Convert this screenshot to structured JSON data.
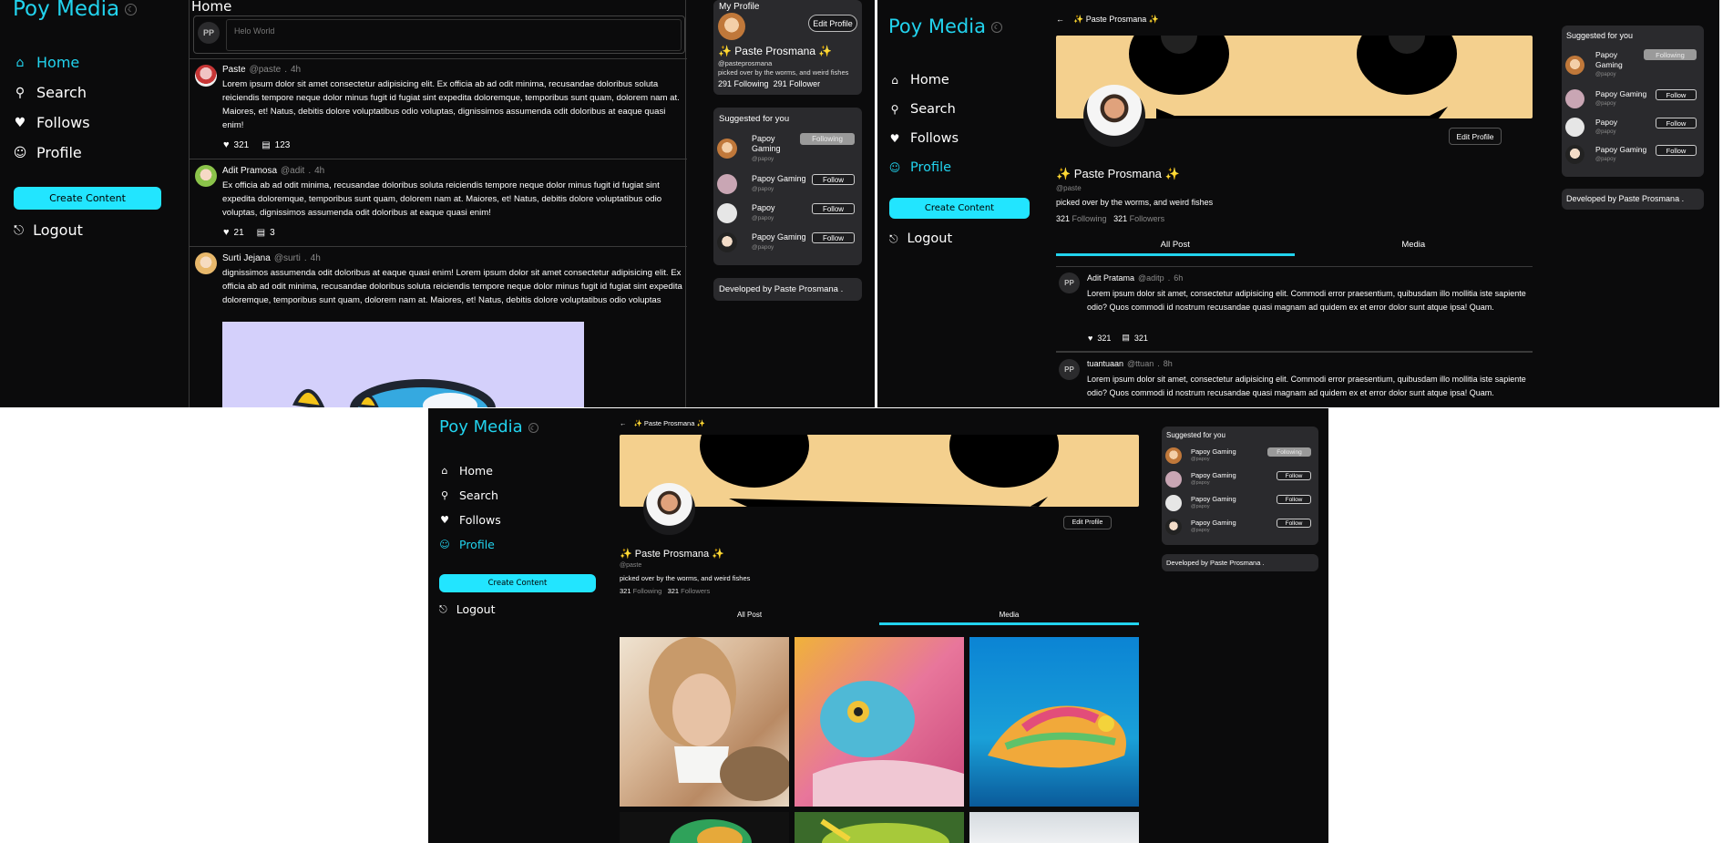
{
  "brand": "Poy Media",
  "theme_toggle_icon": "moon-icon",
  "nav": {
    "home": "Home",
    "search": "Search",
    "follows": "Follows",
    "profile": "Profile"
  },
  "create_label": "Create Content",
  "logout_label": "Logout",
  "home": {
    "title": "Home",
    "composer_avatar": "PP",
    "composer_placeholder": "Helo World",
    "posts": [
      {
        "name": "Paste",
        "handle": "@paste",
        "sep": ".",
        "time": "4h",
        "body": "Lorem ipsum dolor sit amet consectetur adipisicing elit. Ex officia ab ad odit minima, recusandae doloribus soluta reiciendis tempore neque dolor minus fugit id fugiat sint expedita doloremque, temporibus sunt quam, dolorem nam at. Maiores, et! Natus, debitis dolore voluptatibus odio voluptas, dignissimos assumenda odit doloribus at eaque quasi enim!",
        "likes": "321",
        "comments": "123"
      },
      {
        "name": "Adit Pramosa",
        "handle": "@adit",
        "sep": ".",
        "time": "4h",
        "body": "Ex officia ab ad odit minima, recusandae doloribus soluta reiciendis tempore neque dolor minus fugit id fugiat sint expedita doloremque, temporibus sunt quam, dolorem nam at. Maiores, et! Natus, debitis dolore voluptatibus odio voluptas, dignissimos assumenda odit doloribus at eaque quasi enim!",
        "likes": "21",
        "comments": "3"
      },
      {
        "name": "Surti Jejana",
        "handle": "@surti",
        "sep": ".",
        "time": "4h",
        "body": "dignissimos assumenda odit doloribus at eaque quasi enim! Lorem ipsum dolor sit amet consectetur adipisicing elit. Ex officia ab ad odit minima, recusandae doloribus soluta reiciendis tempore neque dolor minus fugit id fugiat sint expedita doloremque, temporibus sunt quam, dolorem nam at. Maiores, et! Natus, debitis dolore voluptatibus odio voluptas"
      }
    ],
    "my_profile": {
      "title": "My Profile",
      "edit": "Edit Profile",
      "name": "✨ Paste Prosmana ✨",
      "handle": "@pasteprosmana",
      "bio": "picked over by the worms, and weird fishes",
      "following_count": "291",
      "following_label": "Following",
      "follower_count": "291",
      "follower_label": "Follower"
    },
    "suggested": {
      "title": "Suggested for you",
      "items": [
        {
          "name": "Papoy Gaming",
          "handle": "@papoy",
          "btn": "Following"
        },
        {
          "name": "Papoy Gaming",
          "handle": "@papoy",
          "btn": "Follow"
        },
        {
          "name": "Papoy",
          "handle": "@papoy",
          "btn": "Follow"
        },
        {
          "name": "Papoy Gaming",
          "handle": "@papoy",
          "btn": "Follow"
        }
      ]
    },
    "footer": "Developed by Paste Prosmana ."
  },
  "profile_page": {
    "back_title": "✨ Paste Prosmana ✨",
    "name": "✨ Paste Prosmana ✨",
    "handle": "@paste",
    "bio": "picked over by the worms, and weird fishes",
    "following_count": "321",
    "following_label": "Following",
    "followers_count": "321",
    "followers_label": "Followers",
    "edit": "Edit Profile",
    "tabs": [
      "All Post",
      "Media"
    ],
    "posts": [
      {
        "avatar": "PP",
        "name": "Adit Pratama",
        "handle": "@aditp",
        "sep": ".",
        "time": "6h",
        "body": "Lorem ipsum dolor sit amet, consectetur adipisicing elit. Commodi error praesentium, quibusdam illo mollitia iste sapiente odio? Quos commodi id nostrum recusandae quasi magnam ad quidem ex et error dolor sunt atque ipsa! Quam.",
        "likes": "321",
        "comments": "321"
      },
      {
        "avatar": "PP",
        "name": "tuantuaan",
        "handle": "@ttuan",
        "sep": ".",
        "time": "8h",
        "body": "Lorem ipsum dolor sit amet, consectetur adipisicing elit. Commodi error praesentium, quibusdam illo mollitia iste sapiente odio? Quos commodi id nostrum recusandae quasi magnam ad quidem ex et error dolor sunt atque ipsa! Quam."
      }
    ],
    "suggested_title": "Suggested for you",
    "suggested": [
      {
        "name": "Papoy Gaming",
        "handle": "@papoy",
        "btn": "Following"
      },
      {
        "name": "Papoy Gaming",
        "handle": "@papoy",
        "btn": "Follow"
      },
      {
        "name": "Papoy",
        "handle": "@papoy",
        "btn": "Follow"
      },
      {
        "name": "Papoy Gaming",
        "handle": "@papoy",
        "btn": "Follow"
      }
    ],
    "footer": "Developed by Paste Prosmana ."
  },
  "media_page": {
    "suggested": [
      {
        "name": "Papoy Gaming",
        "handle": "@papoy",
        "btn": "Following"
      },
      {
        "name": "Papoy Gaming",
        "handle": "@papoy",
        "btn": "Follow"
      },
      {
        "name": "Papoy Gaming",
        "handle": "@papoy",
        "btn": "Follow"
      },
      {
        "name": "Papoy Gaming",
        "handle": "@papoy",
        "btn": "Follow"
      }
    ]
  },
  "colors": {
    "accent": "#22d3ee",
    "background": "#0b0b0c",
    "card": "#2a2a2d",
    "cover": "#f4d08e"
  }
}
